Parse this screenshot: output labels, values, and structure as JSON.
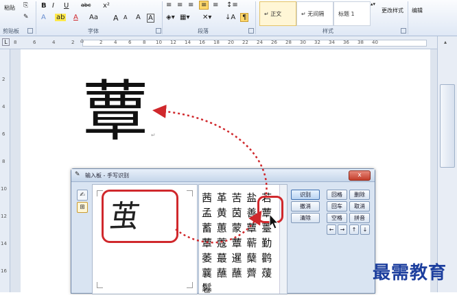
{
  "ribbon": {
    "clipboard": {
      "paste_label": "粘贴",
      "group_label": "剪贴板"
    },
    "font": {
      "group_label": "字体",
      "bold": "B",
      "italic": "I",
      "underline": "U",
      "strike": "abc",
      "superscript": "x²",
      "grow": "A",
      "shrink": "A",
      "font_color": "A",
      "case": "Aa"
    },
    "paragraph": {
      "group_label": "段落"
    },
    "styles": {
      "group_label": "样式",
      "items": [
        "↵ 正文",
        "↵ 无间隔",
        "标题 1"
      ],
      "change_styles": "更改样式"
    },
    "editing": {
      "label": "编辑"
    }
  },
  "ruler": {
    "numbers": [
      "8",
      "6",
      "4",
      "2",
      "2",
      "4",
      "6",
      "8",
      "10",
      "12",
      "14",
      "16",
      "18",
      "20",
      "22",
      "24",
      "26",
      "28",
      "30",
      "32",
      "34",
      "36",
      "38",
      "40"
    ]
  },
  "vruler": {
    "numbers": [
      "2",
      "4",
      "6",
      "8",
      "10",
      "12",
      "14",
      "16"
    ]
  },
  "document": {
    "recognized_char": "蕈"
  },
  "ime": {
    "title": "输入板 - 手写识别",
    "close_label": "x",
    "handwriting": "茧",
    "candidates": [
      "茜 革 苦 盐 若",
      "孟 黄 茵 善 蕈",
      "蓄 蕙 蒙 蕈 薹",
      "蕈 蔻 蕈 蕲 勤",
      "萎 蕞 暹 蘖 鹳",
      "蘘 蘸 蘸 薺 蕿",
      "鬈"
    ],
    "action_buttons": {
      "recognize": "识别",
      "undo": "撤消",
      "clear": "清除"
    },
    "edit_buttons": {
      "backspace": "回格",
      "delete": "删除",
      "enter": "回车",
      "cancel": "取消",
      "space": "空格",
      "tab": "拼音"
    },
    "arrows": {
      "left": "←",
      "right": "→",
      "up": "↑",
      "down": "↓"
    }
  },
  "watermark": "最需教育",
  "colors": {
    "accent_red": "#d0282c",
    "ribbon_blue": "#dfe8f5",
    "watermark_blue": "#1d3f9e"
  }
}
